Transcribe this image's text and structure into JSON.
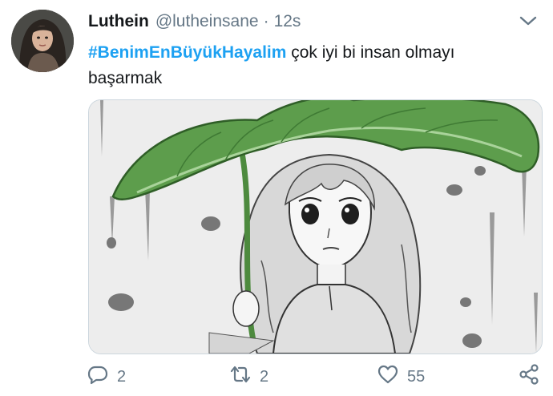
{
  "author": {
    "display_name": "Luthein",
    "handle": "@lutheinsane",
    "separator": "·",
    "time": "12s"
  },
  "tweet": {
    "hashtag": "#BenimEnBüyükHayalim",
    "text": " çok iyi bi insan olmayı başarmak"
  },
  "media": {
    "description_icon": "anime-girl-leaf-umbrella-image"
  },
  "actions": {
    "reply_count": "2",
    "retweet_count": "2",
    "like_count": "55"
  },
  "colors": {
    "accent": "#1da1f2",
    "muted": "#657786",
    "text": "#14171a",
    "leaf": "#5a9a4a"
  }
}
